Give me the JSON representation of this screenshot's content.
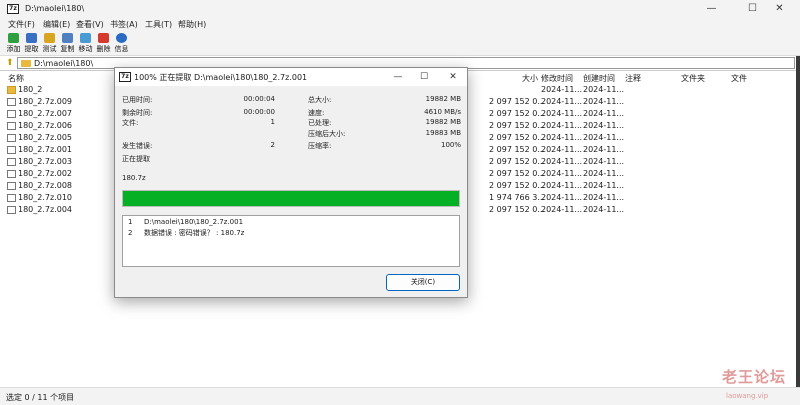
{
  "window": {
    "icon_text": "7z",
    "title": "D:\\maolei\\180\\",
    "minimize": "—",
    "maximize": "☐",
    "close": "✕"
  },
  "menu": [
    "文件(F)",
    "编辑(E)",
    "查看(V)",
    "书签(A)",
    "工具(T)",
    "帮助(H)"
  ],
  "toolbar": [
    {
      "label": "添加",
      "icon": "add-icon",
      "color": "#2e9e3e"
    },
    {
      "label": "提取",
      "icon": "extract-icon",
      "color": "#3a6fc4"
    },
    {
      "label": "测试",
      "icon": "test-icon",
      "color": "#d8a521"
    },
    {
      "label": "复制",
      "icon": "copy-icon",
      "color": "#5080c0"
    },
    {
      "label": "移动",
      "icon": "move-icon",
      "color": "#4a9ad4"
    },
    {
      "label": "删除",
      "icon": "delete-icon",
      "color": "#d43a2e"
    },
    {
      "label": "信息",
      "icon": "info-icon",
      "color": "#2a6cc4"
    }
  ],
  "address": {
    "path": "D:\\maolei\\180\\"
  },
  "columns": {
    "name": "名称",
    "size": "大小",
    "modified": "修改时间",
    "created": "创建时间",
    "comment": "注释",
    "folders": "文件夹",
    "files": "文件"
  },
  "files": [
    {
      "name": "180_2",
      "type": "folder",
      "size": "",
      "modified": "2024-11...",
      "created": "2024-11..."
    },
    {
      "name": "180_2.7z.009",
      "type": "file",
      "size": "2 097 152 0...",
      "modified": "2024-11...",
      "created": "2024-11..."
    },
    {
      "name": "180_2.7z.007",
      "type": "file",
      "size": "2 097 152 0...",
      "modified": "2024-11...",
      "created": "2024-11..."
    },
    {
      "name": "180_2.7z.006",
      "type": "file",
      "size": "2 097 152 0...",
      "modified": "2024-11...",
      "created": "2024-11..."
    },
    {
      "name": "180_2.7z.005",
      "type": "file",
      "size": "2 097 152 0...",
      "modified": "2024-11...",
      "created": "2024-11..."
    },
    {
      "name": "180_2.7z.001",
      "type": "file",
      "size": "2 097 152 0...",
      "modified": "2024-11...",
      "created": "2024-11..."
    },
    {
      "name": "180_2.7z.003",
      "type": "file",
      "size": "2 097 152 0...",
      "modified": "2024-11...",
      "created": "2024-11..."
    },
    {
      "name": "180_2.7z.002",
      "type": "file",
      "size": "2 097 152 0...",
      "modified": "2024-11...",
      "created": "2024-11..."
    },
    {
      "name": "180_2.7z.008",
      "type": "file",
      "size": "2 097 152 0...",
      "modified": "2024-11...",
      "created": "2024-11..."
    },
    {
      "name": "180_2.7z.010",
      "type": "file",
      "size": "1 974 766 3...",
      "modified": "2024-11...",
      "created": "2024-11..."
    },
    {
      "name": "180_2.7z.004",
      "type": "file",
      "size": "2 097 152 0...",
      "modified": "2024-11...",
      "created": "2024-11..."
    }
  ],
  "status": {
    "text": "选定 0 / 11 个项目"
  },
  "watermark": {
    "text": "老王论坛",
    "sub": "laowang.vip"
  },
  "dialog": {
    "title": "100% 正在提取 D:\\maolei\\180\\180_2.7z.001",
    "left": [
      {
        "label": "已用时间:",
        "value": "00:00:04"
      },
      {
        "label": "剩余时间:",
        "value": "00:00:00"
      },
      {
        "label": "文件:",
        "value": "1"
      },
      {
        "label": "",
        "value": ""
      },
      {
        "label": "发生错误:",
        "value": "2"
      },
      {
        "label": "正在提取",
        "value": ""
      }
    ],
    "right": [
      {
        "label": "总大小:",
        "value": "19882 MB"
      },
      {
        "label": "速度:",
        "value": "4610 MB/s"
      },
      {
        "label": "已处理:",
        "value": "19882 MB"
      },
      {
        "label": "压缩后大小:",
        "value": "19883 MB"
      },
      {
        "label": "压缩率:",
        "value": "100%"
      }
    ],
    "current_file": "180.7z",
    "progress_percent": 100,
    "messages": [
      {
        "num": "1",
        "text": "D:\\maolei\\180\\180_2.7z.001"
      },
      {
        "num": "2",
        "text": "数据错误 : 密码错误？ : 180.7z"
      }
    ],
    "close_label": "关闭(C)",
    "accent_color": "#06b025"
  }
}
